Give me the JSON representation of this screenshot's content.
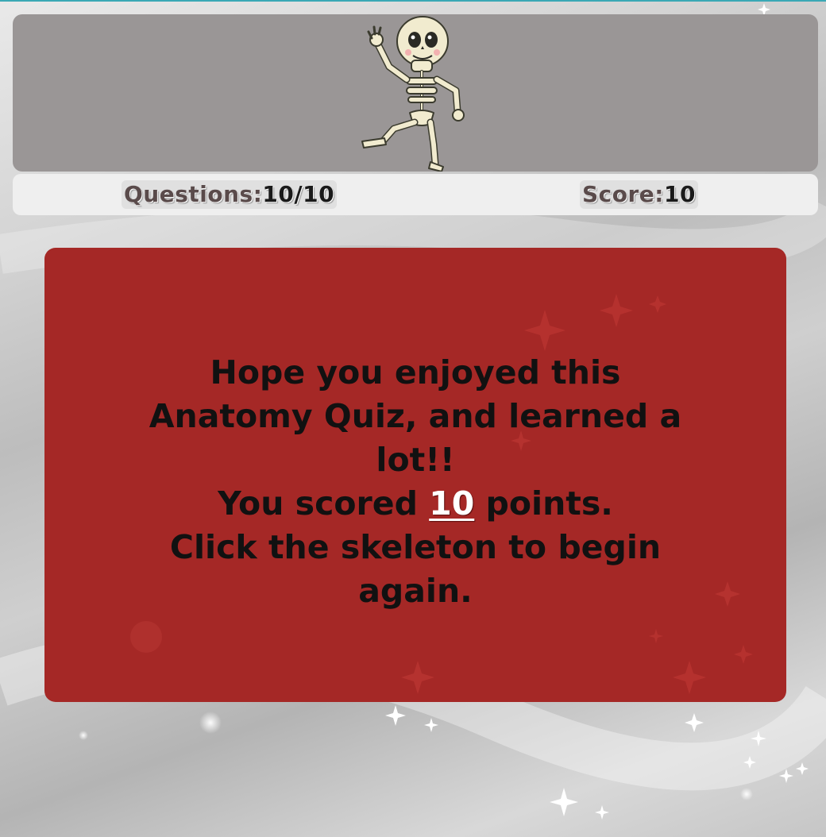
{
  "status": {
    "questions_label": "Questions:",
    "questions_value": "10/10",
    "score_label": "Score:",
    "score_value": "10"
  },
  "message": {
    "intro": "Hope you enjoyed this Anatomy Quiz, and learned a lot!!",
    "scored_prefix": "You scored ",
    "scored_value": "10",
    "scored_suffix": " points.",
    "restart": "Click the skeleton to begin again."
  },
  "colors": {
    "header_panel": "#9a9696",
    "status_bar": "#efefef",
    "card": "#a52826",
    "message_text": "#111111",
    "score_highlight": "#ffffff",
    "top_accent": "#3aa8b5"
  },
  "icons": {
    "mascot": "dancing-skeleton-icon"
  }
}
